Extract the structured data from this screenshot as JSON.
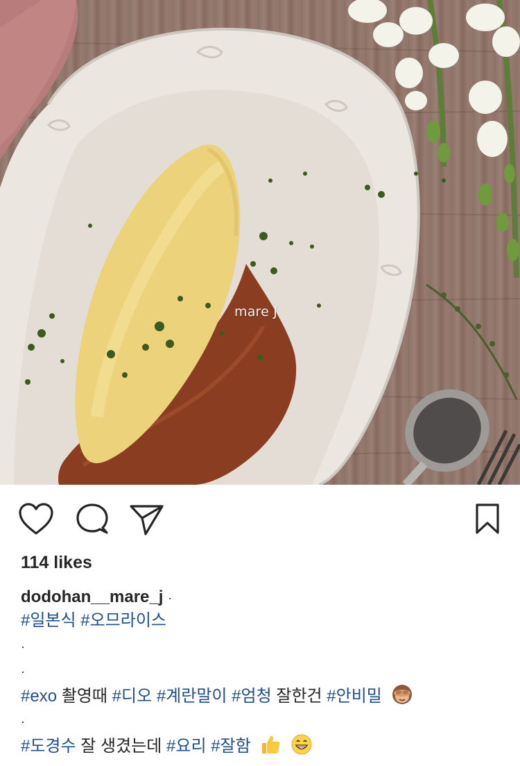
{
  "photo": {
    "alt": "omurice",
    "watermark": "mare J"
  },
  "actions": {
    "like_icon": "heart-outline-icon",
    "comment_icon": "comment-bubble-icon",
    "share_icon": "paper-plane-icon",
    "save_icon": "bookmark-outline-icon"
  },
  "post": {
    "likes": "114 likes",
    "username": "dodohan__mare_j",
    "username_suffix": "·",
    "caption": {
      "line1": {
        "tag1": "#일본식",
        "tag2": "#오므라이스"
      },
      "dot1": "·",
      "dot2": "·",
      "line4": {
        "tag1": "#exo",
        "text1": "촬영때",
        "tag2": "#디오",
        "tag3": "#계란말이",
        "tag4": "#엄청",
        "text2": "잘한건",
        "tag5": "#안비밀",
        "emoji": "see-no-evil-monkey-emoji"
      },
      "dot3": "·",
      "line6": {
        "tag1": "#도경수",
        "text1": "잘 생겼는데",
        "tag2": "#요리",
        "tag3": "#잘함",
        "emoji1": "thumbs-up-emoji",
        "emoji2": "grinning-face-emoji"
      }
    }
  },
  "colors": {
    "hashtag": "#1f4f8f",
    "text": "#262626",
    "background": "#ffffff"
  }
}
